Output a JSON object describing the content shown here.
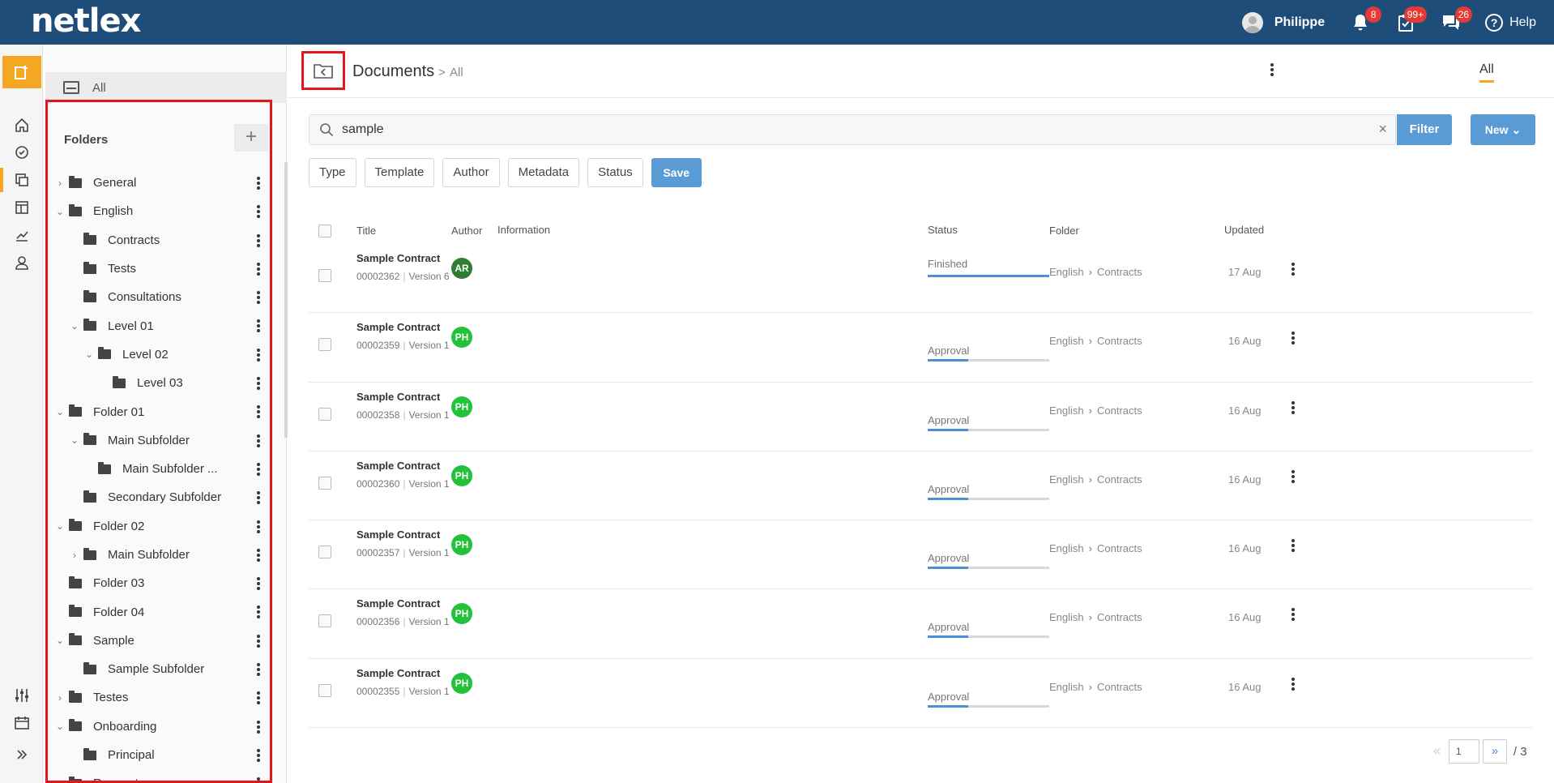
{
  "app": {
    "logo": "netlex"
  },
  "header": {
    "user_name": "Philippe",
    "notifications_count": "8",
    "tasks_count": "99+",
    "messages_count": "26",
    "help_label": "Help"
  },
  "panel": {
    "all_label": "All",
    "folders_title": "Folders",
    "tree": [
      {
        "label": "General",
        "level": 0,
        "chevron": "right"
      },
      {
        "label": "English",
        "level": 0,
        "chevron": "down"
      },
      {
        "label": "Contracts",
        "level": 1,
        "chevron": ""
      },
      {
        "label": "Tests",
        "level": 1,
        "chevron": ""
      },
      {
        "label": "Consultations",
        "level": 1,
        "chevron": ""
      },
      {
        "label": "Level 01",
        "level": 1,
        "chevron": "down"
      },
      {
        "label": "Level 02",
        "level": 2,
        "chevron": "down"
      },
      {
        "label": "Level 03",
        "level": 3,
        "chevron": ""
      },
      {
        "label": "Folder 01",
        "level": 0,
        "chevron": "down"
      },
      {
        "label": "Main Subfolder",
        "level": 1,
        "chevron": "down"
      },
      {
        "label": "Main Subfolder ...",
        "level": 2,
        "chevron": ""
      },
      {
        "label": "Secondary Subfolder",
        "level": 1,
        "chevron": ""
      },
      {
        "label": "Folder 02",
        "level": 0,
        "chevron": "down"
      },
      {
        "label": "Main Subfolder",
        "level": 1,
        "chevron": "right"
      },
      {
        "label": "Folder 03",
        "level": 0,
        "chevron": ""
      },
      {
        "label": "Folder 04",
        "level": 0,
        "chevron": ""
      },
      {
        "label": "Sample",
        "level": 0,
        "chevron": "down"
      },
      {
        "label": "Sample Subfolder",
        "level": 1,
        "chevron": ""
      },
      {
        "label": "Testes",
        "level": 0,
        "chevron": "right"
      },
      {
        "label": "Onboarding",
        "level": 0,
        "chevron": "down"
      },
      {
        "label": "Principal",
        "level": 1,
        "chevron": ""
      },
      {
        "label": "Requests",
        "level": 0,
        "chevron": ""
      }
    ]
  },
  "main": {
    "title": "Documents",
    "crumb_sep": ">",
    "crumb_all": "All",
    "view_all": "All",
    "search": {
      "value": "sample",
      "clear": "×"
    },
    "filter_label": "Filter",
    "new_label": "New",
    "chips": [
      "Type",
      "Template",
      "Author",
      "Metadata",
      "Status"
    ],
    "save_label": "Save",
    "columns": {
      "title": "Title",
      "author": "Author",
      "information": "Information",
      "status": "Status",
      "folder": "Folder",
      "updated": "Updated"
    },
    "rows": [
      {
        "title": "Sample Contract",
        "id": "00002362",
        "version": "Version 6",
        "author": "AR",
        "author_color": "#2e7d32",
        "status": "Finished",
        "progress": 1.0,
        "folder1": "English",
        "folder2": "Contracts",
        "updated": "17 Aug"
      },
      {
        "title": "Sample Contract",
        "id": "00002359",
        "version": "Version 1",
        "author": "PH",
        "author_color": "#22c33a",
        "status": "Approval",
        "progress": 0.33,
        "folder1": "English",
        "folder2": "Contracts",
        "updated": "16 Aug"
      },
      {
        "title": "Sample Contract",
        "id": "00002358",
        "version": "Version 1",
        "author": "PH",
        "author_color": "#22c33a",
        "status": "Approval",
        "progress": 0.33,
        "folder1": "English",
        "folder2": "Contracts",
        "updated": "16 Aug"
      },
      {
        "title": "Sample Contract",
        "id": "00002360",
        "version": "Version 1",
        "author": "PH",
        "author_color": "#22c33a",
        "status": "Approval",
        "progress": 0.33,
        "folder1": "English",
        "folder2": "Contracts",
        "updated": "16 Aug"
      },
      {
        "title": "Sample Contract",
        "id": "00002357",
        "version": "Version 1",
        "author": "PH",
        "author_color": "#22c33a",
        "status": "Approval",
        "progress": 0.33,
        "folder1": "English",
        "folder2": "Contracts",
        "updated": "16 Aug"
      },
      {
        "title": "Sample Contract",
        "id": "00002356",
        "version": "Version 1",
        "author": "PH",
        "author_color": "#22c33a",
        "status": "Approval",
        "progress": 0.33,
        "folder1": "English",
        "folder2": "Contracts",
        "updated": "16 Aug"
      },
      {
        "title": "Sample Contract",
        "id": "00002355",
        "version": "Version 1",
        "author": "PH",
        "author_color": "#22c33a",
        "status": "Approval",
        "progress": 0.33,
        "folder1": "English",
        "folder2": "Contracts",
        "updated": "16 Aug"
      }
    ],
    "pager": {
      "page": "1",
      "total": "/ 3"
    }
  }
}
